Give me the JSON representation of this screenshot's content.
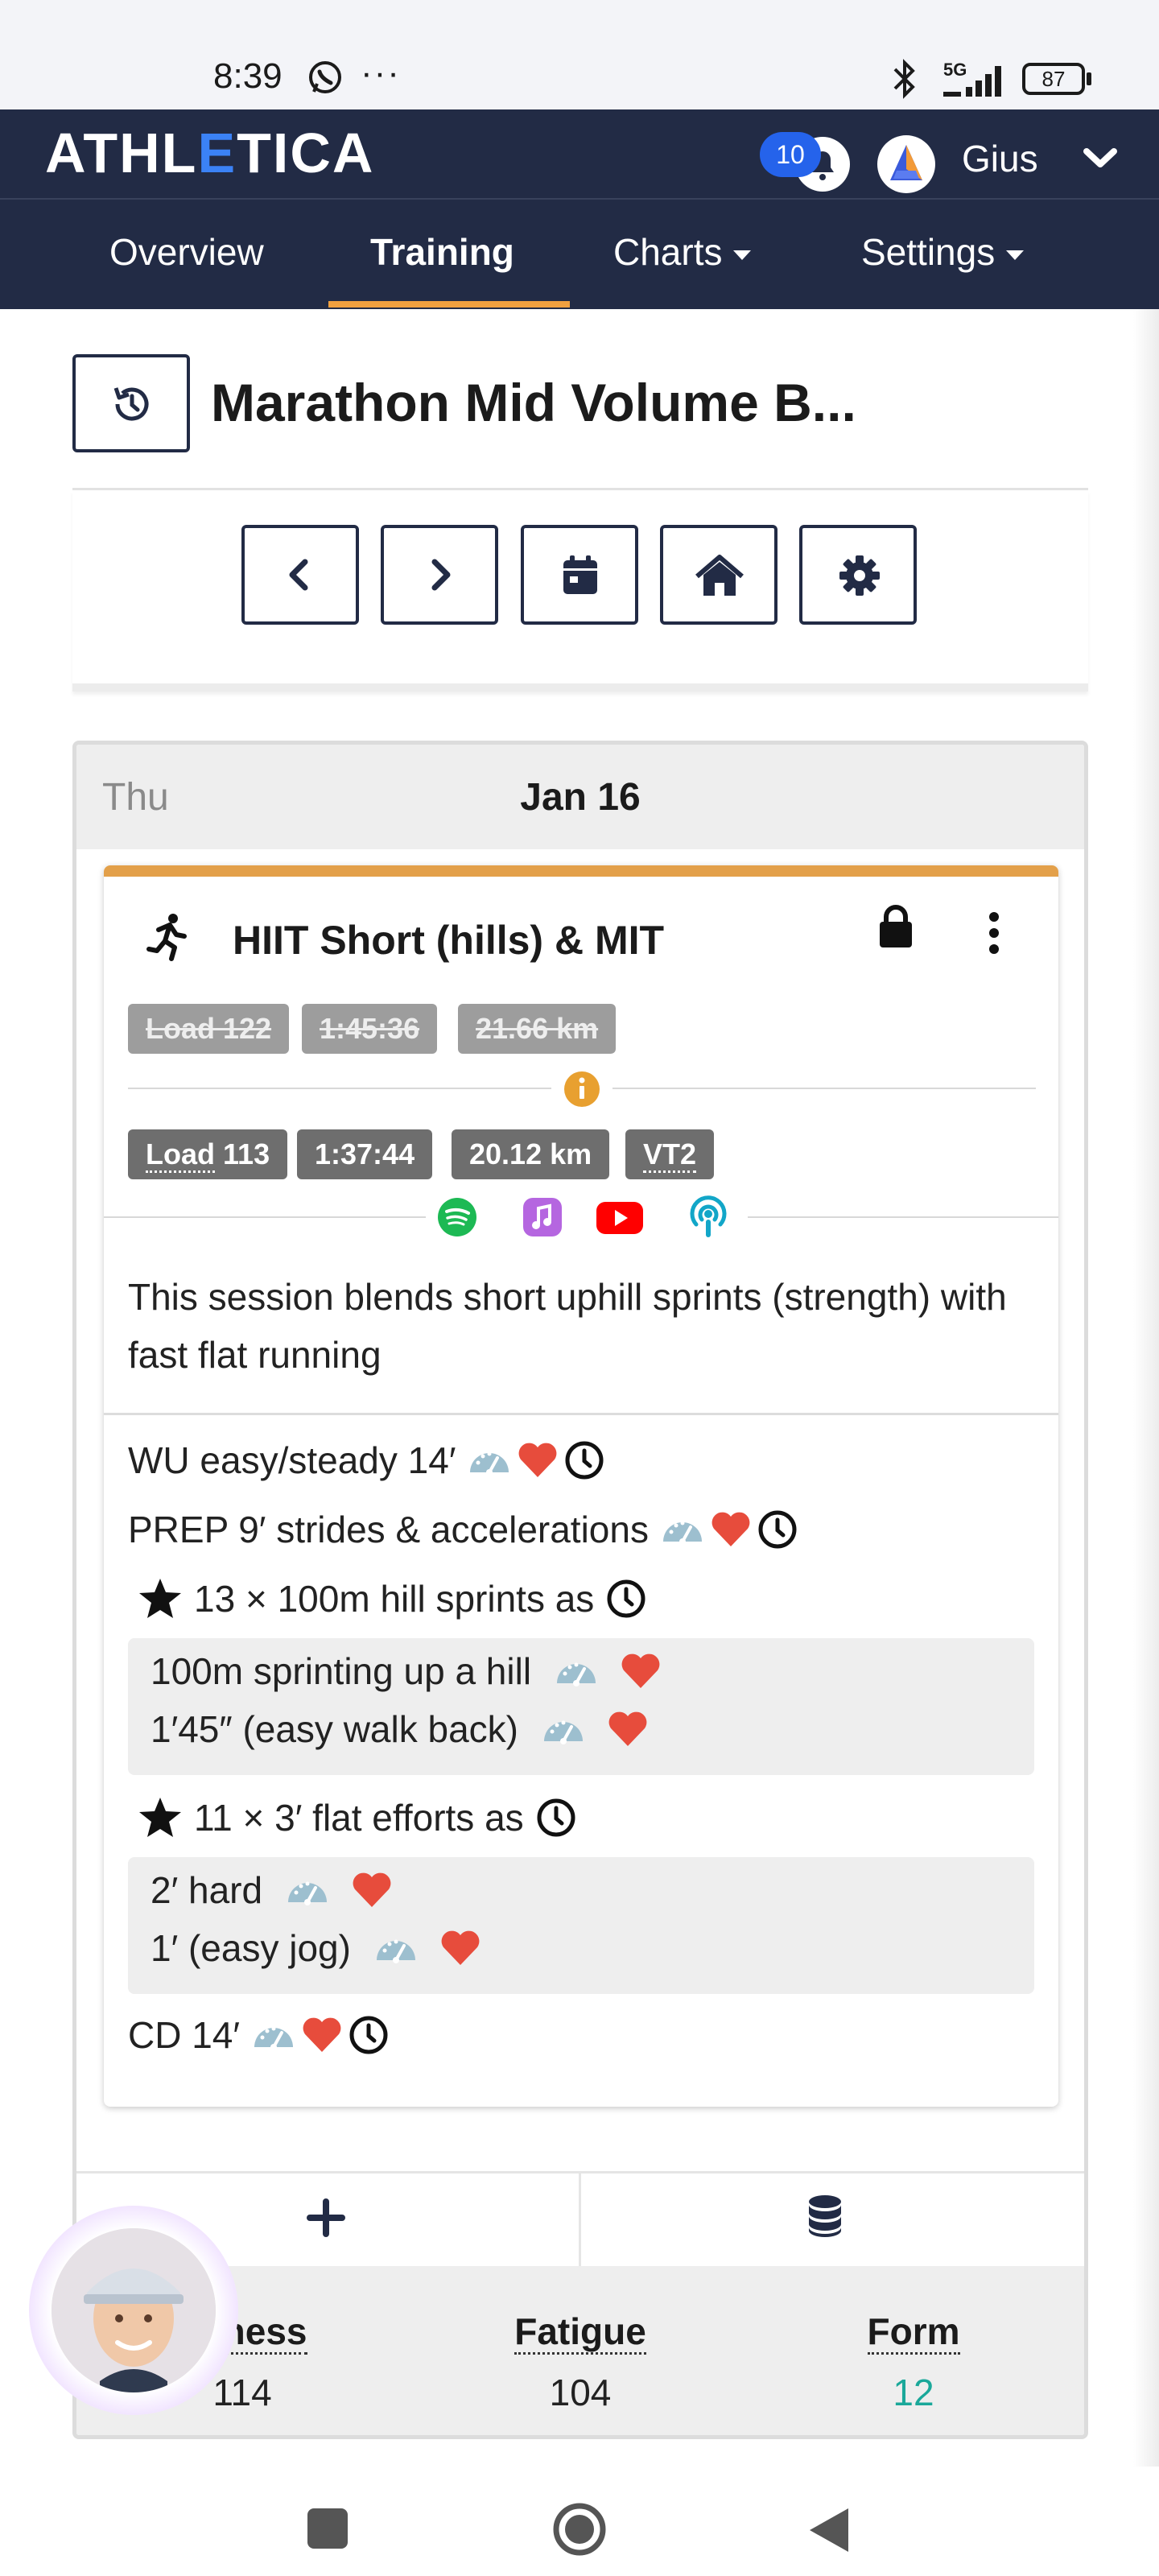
{
  "status_bar": {
    "time": "8:39",
    "more": "···",
    "network": "5G",
    "battery": "87"
  },
  "navbar": {
    "brand": "ATHLETICA",
    "notification_count": "10",
    "user_name": "Gius",
    "tabs": [
      {
        "label": "Overview",
        "active": false
      },
      {
        "label": "Training",
        "active": true
      },
      {
        "label": "Charts",
        "dropdown": true
      },
      {
        "label": "Settings",
        "dropdown": true
      }
    ],
    "accent_color": "#f0a040",
    "background_color": "#222b45"
  },
  "header": {
    "title": "Marathon Mid Volume B...",
    "toolbar": [
      "previous",
      "next",
      "calendar",
      "home",
      "settings"
    ]
  },
  "day": {
    "weekday": "Thu",
    "date": "Jan 16"
  },
  "workout": {
    "title": "HIIT Short (hills) & MIT",
    "stripe_color": "#e3a04a",
    "original_stats": [
      "Load 122",
      "1:45:36",
      "21.66 km"
    ],
    "adjusted_stats": [
      "Load",
      "113",
      "1:37:44",
      "20.12 km",
      "VT2"
    ],
    "music_links": [
      "spotify-icon",
      "apple-music-icon",
      "youtube-icon",
      "podcast-icon"
    ],
    "description": "This session blends short uphill sprints (strength) with fast flat running",
    "steps": {
      "wu": "WU easy/steady 14′",
      "prep": "PREP 9′ strides & accelerations",
      "set1_header": "13 × 100m hill sprints as",
      "set1_work": "100m sprinting up a hill",
      "set1_rest": "1′45″ (easy walk back)",
      "set2_header": "11 × 3′ flat efforts as",
      "set2_work": "2′ hard",
      "set2_rest": "1′ (easy jog)",
      "cd": "CD 14′"
    }
  },
  "stats": {
    "fitness_label": "Fitness",
    "fitness_value": "114",
    "fatigue_label": "Fatigue",
    "fatigue_value": "104",
    "form_label": "Form",
    "form_value": "12",
    "form_color": "#1aa89a"
  }
}
